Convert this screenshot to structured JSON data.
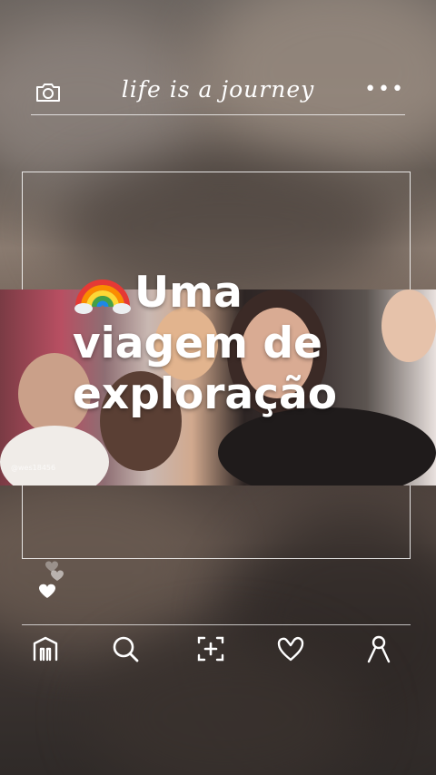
{
  "header": {
    "title": "life is a journey",
    "camera_icon": "camera-icon",
    "more_icon": "more-dots-icon"
  },
  "photo": {
    "watermark": "@wes18456"
  },
  "caption": {
    "emoji": "rainbow",
    "line1": "Uma",
    "line2": "viagem de",
    "line3": "exploração"
  },
  "bottom_nav": {
    "items": [
      {
        "icon": "home-icon"
      },
      {
        "icon": "search-icon"
      },
      {
        "icon": "add-post-icon"
      },
      {
        "icon": "heart-icon"
      },
      {
        "icon": "profile-icon"
      }
    ]
  },
  "colors": {
    "foreground": "#ffffff"
  }
}
